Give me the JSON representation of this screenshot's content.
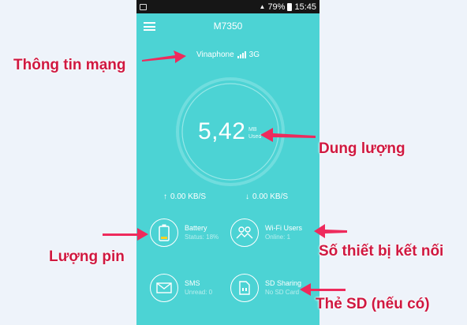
{
  "status_bar": {
    "signal": "79%",
    "time": "15:45"
  },
  "app": {
    "device_name": "M7350",
    "carrier": "Vinaphone",
    "network_badge": "3G",
    "network_small": "3G"
  },
  "usage": {
    "value": "5,42",
    "unit_top": "MB",
    "unit_bottom": "Used"
  },
  "speeds": {
    "upload": "0.00 KB/S",
    "download": "0.00 KB/S"
  },
  "tiles": {
    "battery": {
      "title": "Battery",
      "status": "Status: 18%"
    },
    "wifi_users": {
      "title": "Wi-Fi Users",
      "status": "Online: 1"
    },
    "sms": {
      "title": "SMS",
      "status": "Unread: 0"
    },
    "sd": {
      "title": "SD Sharing",
      "status": "No SD Card"
    }
  },
  "callouts": {
    "network_info": "Thông tin mạng",
    "capacity": "Dung lượng",
    "battery": "Lượng pin",
    "devices": "Số thiết bị kết nối",
    "sd_card": "Thẻ SD (nếu có)"
  },
  "colors": {
    "app_bg": "#4cd3d4",
    "callout": "#d01840",
    "arrow": "#ee2a5c",
    "battery_fill": "#ffd21f"
  }
}
